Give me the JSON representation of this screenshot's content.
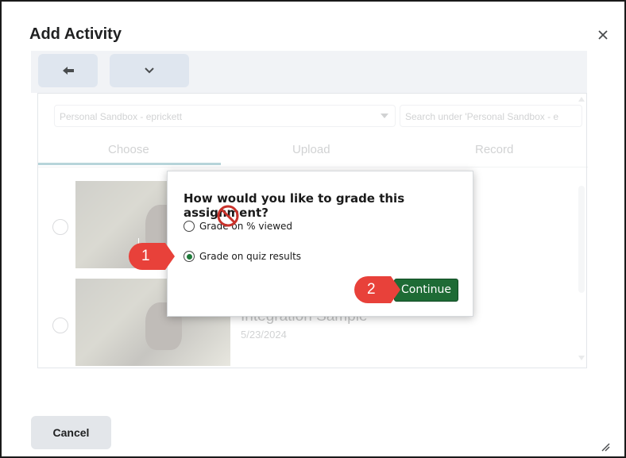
{
  "dialog": {
    "title": "Add Activity",
    "close_icon": "close-icon"
  },
  "toolbar": {
    "back_icon": "arrow-left-icon",
    "more_icon": "chevron-down-icon"
  },
  "content": {
    "folder_select_value": "Personal Sandbox - eprickett",
    "search_placeholder": "Search under 'Personal Sandbox - e",
    "tabs": [
      {
        "label": "Choose"
      },
      {
        "label": "Upload"
      },
      {
        "label": "Record"
      }
    ],
    "active_tab": "Choose",
    "rows": [
      {
        "title": "",
        "date": ""
      },
      {
        "title": "Integration Sample",
        "date": "5/23/2024"
      }
    ]
  },
  "popup": {
    "question": "How would you like to grade this assignment?",
    "options": [
      {
        "label": "Grade on % viewed",
        "checked": false
      },
      {
        "label": "Grade on quiz results",
        "checked": true
      }
    ],
    "continue_label": "Continue"
  },
  "annotations": {
    "callout_1": "1",
    "callout_2": "2",
    "callout_color": "#e8413a",
    "no_entry_icon": "no-entry-icon"
  },
  "footer": {
    "cancel_label": "Cancel"
  },
  "colors": {
    "accent": "#1e7a8a",
    "continue_button": "#1e6b35"
  }
}
